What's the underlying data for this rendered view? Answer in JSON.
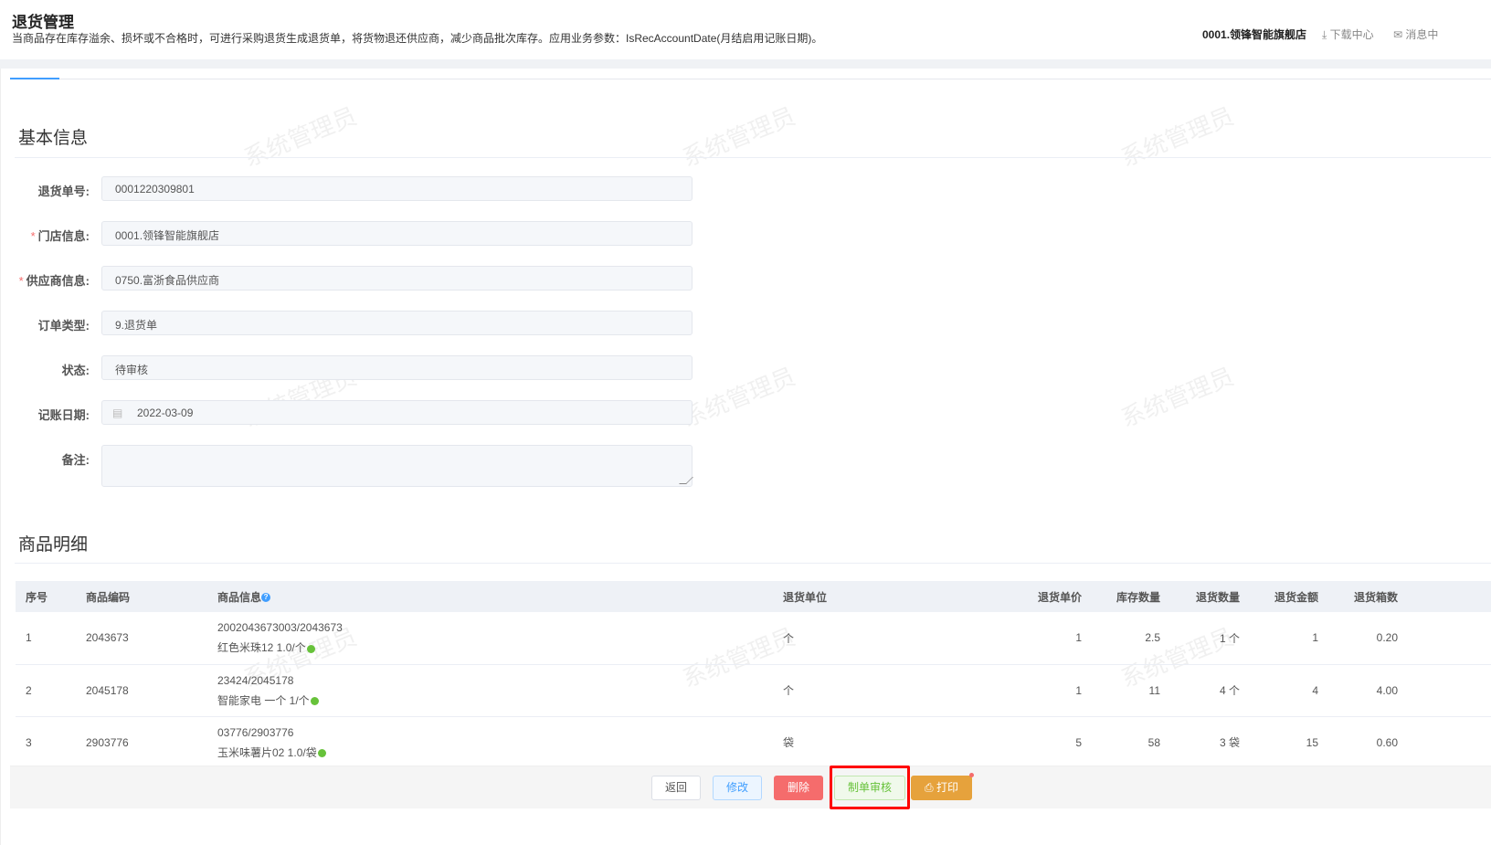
{
  "header": {
    "title": "退货管理",
    "description": "当商品存在库存溢余、损坏或不合格时，可进行采购退货生成退货单，将货物退还供应商，减少商品批次库存。应用业务参数：IsRecAccountDate(月结启用记账日期)。",
    "store": "0001.领锋智能旗舰店",
    "download": "下载中心",
    "messages": "消息中"
  },
  "watermark": "系统管理员",
  "basic": {
    "title": "基本信息",
    "fields": [
      {
        "label": "退货单号:",
        "value": "0001220309801",
        "required": false
      },
      {
        "label": "门店信息:",
        "value": "0001.领锋智能旗舰店",
        "required": true
      },
      {
        "label": "供应商信息:",
        "value": "0750.富浙食品供应商",
        "required": true
      },
      {
        "label": "订单类型:",
        "value": "9.退货单",
        "required": false
      },
      {
        "label": "状态:",
        "value": "待审核",
        "required": false
      },
      {
        "label": "记账日期:",
        "value": "2022-03-09",
        "required": false
      },
      {
        "label": "备注:",
        "value": "",
        "required": false
      }
    ]
  },
  "detail": {
    "title": "商品明细",
    "columns": [
      "序号",
      "商品编码",
      "商品信息",
      "退货单位",
      "退货单价",
      "库存数量",
      "退货数量",
      "退货金额",
      "退货箱数"
    ],
    "rows": [
      {
        "no": "1",
        "code": "2043673",
        "barcode": "2002043673003/2043673",
        "name": "红色米珠12 1.0/个",
        "unit": "个",
        "price": "1",
        "stock": "2.5",
        "qty": "1 个",
        "amount": "1",
        "boxes": "0.20"
      },
      {
        "no": "2",
        "code": "2045178",
        "barcode": "23424/2045178",
        "name": "智能家电 一个 1/个",
        "unit": "个",
        "price": "1",
        "stock": "11",
        "qty": "4 个",
        "amount": "4",
        "boxes": "4.00"
      },
      {
        "no": "3",
        "code": "2903776",
        "barcode": "03776/2903776",
        "name": "玉米味薯片02 1.0/袋",
        "unit": "袋",
        "price": "5",
        "stock": "58",
        "qty": "3 袋",
        "amount": "15",
        "boxes": "0.60"
      }
    ]
  },
  "buttons": {
    "back": "返回",
    "edit": "修改",
    "delete": "删除",
    "audit": "制单审核",
    "print": "打印"
  }
}
